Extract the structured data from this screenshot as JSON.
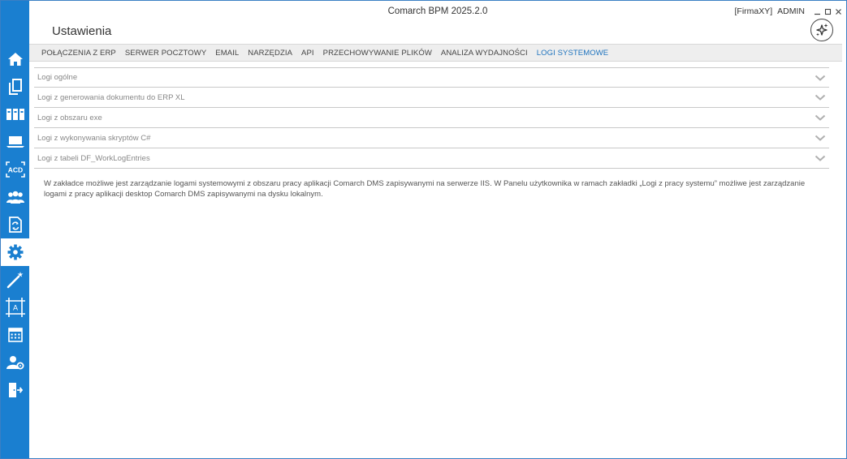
{
  "window": {
    "app_title": "Comarch BPM 2025.2.0",
    "company": "[FirmaXY]",
    "user": "ADMIN"
  },
  "page": {
    "title": "Ustawienia"
  },
  "tabs": [
    {
      "label": "POŁĄCZENIA Z ERP",
      "active": false
    },
    {
      "label": "SERWER POCZTOWY",
      "active": false
    },
    {
      "label": "EMAIL",
      "active": false
    },
    {
      "label": "NARZĘDZIA",
      "active": false
    },
    {
      "label": "API",
      "active": false
    },
    {
      "label": "PRZECHOWYWANIE PLIKÓW",
      "active": false
    },
    {
      "label": "ANALIZA WYDAJNOŚCI",
      "active": false
    },
    {
      "label": "LOGI SYSTEMOWE",
      "active": true
    }
  ],
  "sections": [
    {
      "label": "Logi ogólne"
    },
    {
      "label": "Logi z generowania dokumentu do ERP XL"
    },
    {
      "label": "Logi z obszaru exe"
    },
    {
      "label": "Logi z wykonywania skryptów C#"
    },
    {
      "label": "Logi z tabeli DF_WorkLogEntries"
    }
  ],
  "info_text": "W zakładce możliwe jest zarządzanie logami systemowymi z obszaru pracy aplikacji Comarch DMS zapisywanymi na serwerze IIS. W Panelu użytkownika w ramach zakładki „Logi z pracy systemu” możliwe jest zarządzanie logami z pracy aplikacji desktop Comarch DMS zapisywanymi na dysku lokalnym.",
  "sidebar": {
    "items": [
      {
        "icon": "home-icon"
      },
      {
        "icon": "documents-icon"
      },
      {
        "icon": "binders-icon"
      },
      {
        "icon": "laptop-icon"
      },
      {
        "icon": "acd-icon",
        "text": "ACD"
      },
      {
        "icon": "users-icon"
      },
      {
        "icon": "document-sync-icon"
      },
      {
        "icon": "gear-icon",
        "active": true
      },
      {
        "icon": "magic-wand-icon"
      },
      {
        "icon": "designer-frame-icon",
        "text": "A"
      },
      {
        "icon": "calendar-icon"
      },
      {
        "icon": "user-settings-icon"
      },
      {
        "icon": "logout-icon"
      }
    ]
  },
  "colors": {
    "sidebar": "#1a7fd0",
    "accent": "#1e73be",
    "tabbar": "#eeeeee"
  }
}
